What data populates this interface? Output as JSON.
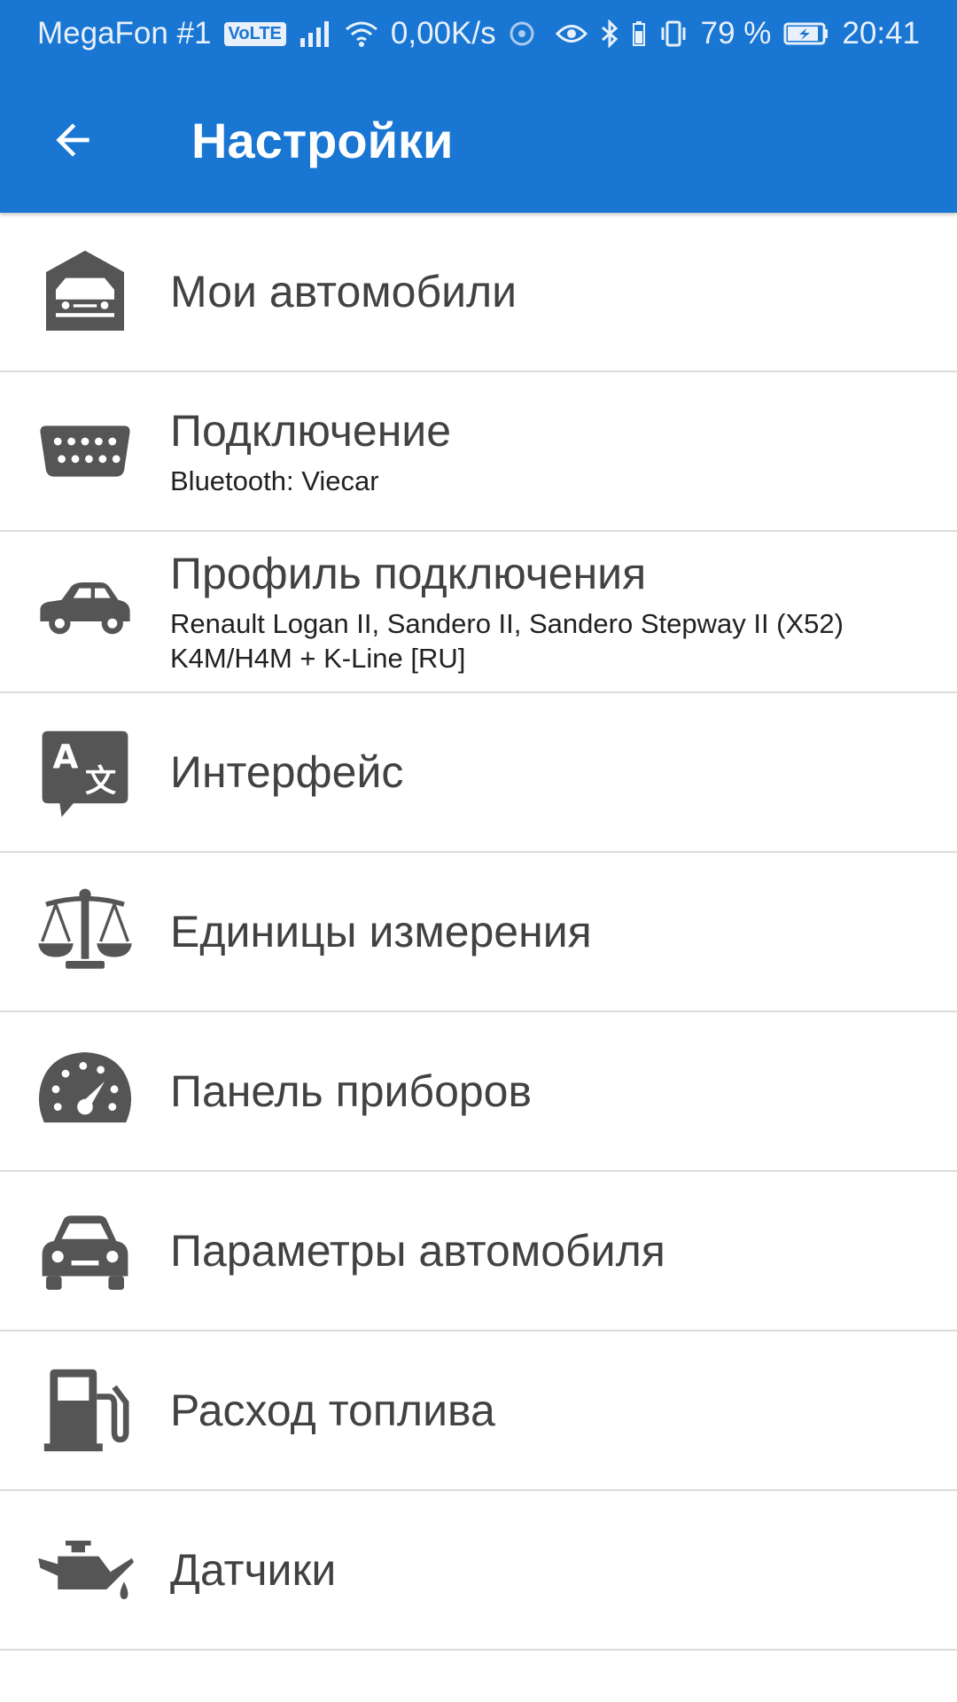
{
  "status_bar": {
    "carrier": "MegaFon #1",
    "volte": "VoLTE",
    "speed": "0,00K/s",
    "battery": "79 %",
    "time": "20:41"
  },
  "app_bar": {
    "title": "Настройки",
    "back_icon": "arrow-back-icon",
    "color": "#1976D2"
  },
  "settings": [
    {
      "label": "Мои автомобили",
      "icon": "garage-icon"
    },
    {
      "label": "Подключение",
      "sublabel": "Bluetooth: Viecar",
      "icon": "obd-connector-icon"
    },
    {
      "label": "Профиль подключения",
      "sublabel": "Renault Logan II, Sandero II, Sandero Stepway II (X52)\nK4M/H4M + K-Line [RU]",
      "icon": "car-side-icon"
    },
    {
      "label": "Интерфейс",
      "icon": "translate-icon"
    },
    {
      "label": "Единицы измерения",
      "icon": "scale-icon"
    },
    {
      "label": "Панель приборов",
      "icon": "speedometer-icon"
    },
    {
      "label": "Параметры автомобиля",
      "icon": "car-front-icon"
    },
    {
      "label": "Расход топлива",
      "icon": "fuel-pump-icon"
    },
    {
      "label": "Датчики",
      "icon": "oil-can-icon"
    }
  ]
}
